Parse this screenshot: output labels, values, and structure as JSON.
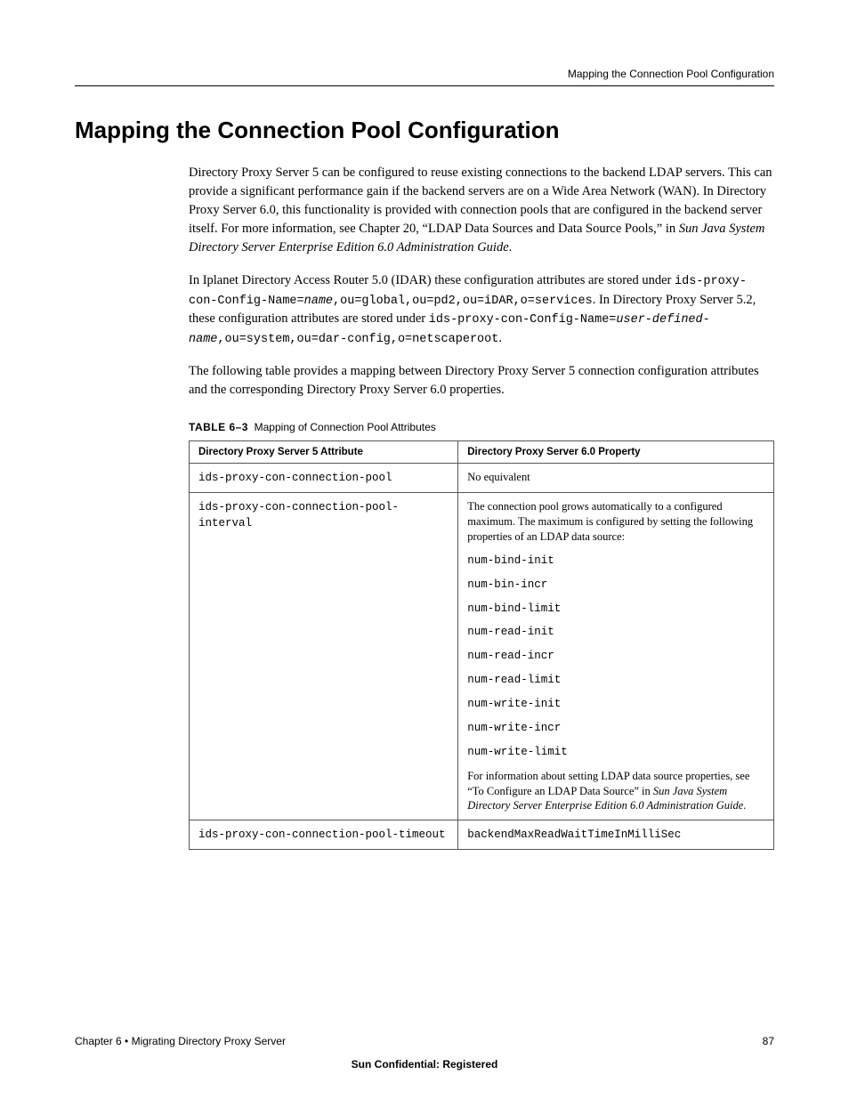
{
  "header": {
    "running": "Mapping the Connection Pool Configuration"
  },
  "heading": "Mapping the Connection Pool Configuration",
  "para1a": "Directory Proxy Server 5 can be configured to reuse existing connections to the backend LDAP servers. This can provide a significant performance gain if the backend servers are on a Wide Area Network (WAN). In Directory Proxy Server 6.0, this functionality is provided with connection pools that are configured in the backend server itself. For more information, see Chapter 20, “LDAP Data Sources and Data Source Pools,” in ",
  "para1b": "Sun Java System Directory Server Enterprise Edition 6.0 Administration Guide",
  "para1c": ".",
  "para2a": "In Iplanet Directory Access Router 5.0 (IDAR) these configuration attributes are stored under ",
  "para2b": "ids-proxy-con-Config-Name=",
  "para2c": "name",
  "para2d": ",ou=global,ou=pd2,ou=iDAR,o=services",
  "para2e": ". In Directory Proxy Server 5.2, these configuration attributes are stored under ",
  "para2f": "ids-proxy-con-Config-Name=",
  "para2g": "user-defined-name",
  "para2h": ",ou=system,ou=dar-config,o=netscaperoot",
  "para2i": ".",
  "para3": "The following table provides a mapping between Directory Proxy Server 5 connection configuration attributes and the corresponding Directory Proxy Server 6.0 properties.",
  "tableCaption": {
    "label": "TABLE 6–3",
    "title": "Mapping of Connection Pool Attributes"
  },
  "table": {
    "headers": [
      "Directory Proxy Server 5 Attribute",
      "Directory Proxy Server 6.0 Property"
    ],
    "rows": [
      {
        "attr": "ids-proxy-con-connection-pool",
        "prop": {
          "text": "No equivalent"
        }
      },
      {
        "attr": "ids-proxy-con-connection-pool-interval",
        "prop": {
          "intro": "The connection pool grows automatically to a configured maximum. The maximum is configured by setting the following properties of an LDAP data source:",
          "list": [
            "num-bind-init",
            "num-bin-incr",
            "num-bind-limit",
            "num-read-init",
            "num-read-incr",
            "num-read-limit",
            "num-write-init",
            "num-write-incr",
            "num-write-limit"
          ],
          "out_a": "For information about setting LDAP data source properties, see “To Configure an LDAP Data Source” in ",
          "out_b": "Sun Java System Directory Server Enterprise Edition 6.0 Administration Guide",
          "out_c": "."
        }
      },
      {
        "attr": "ids-proxy-con-connection-pool-timeout",
        "prop": {
          "mono": "backendMaxReadWaitTimeInMilliSec"
        }
      }
    ]
  },
  "footer": {
    "left": "Chapter 6 • Migrating Directory Proxy Server",
    "right": "87",
    "confidential": "Sun Confidential: Registered"
  }
}
